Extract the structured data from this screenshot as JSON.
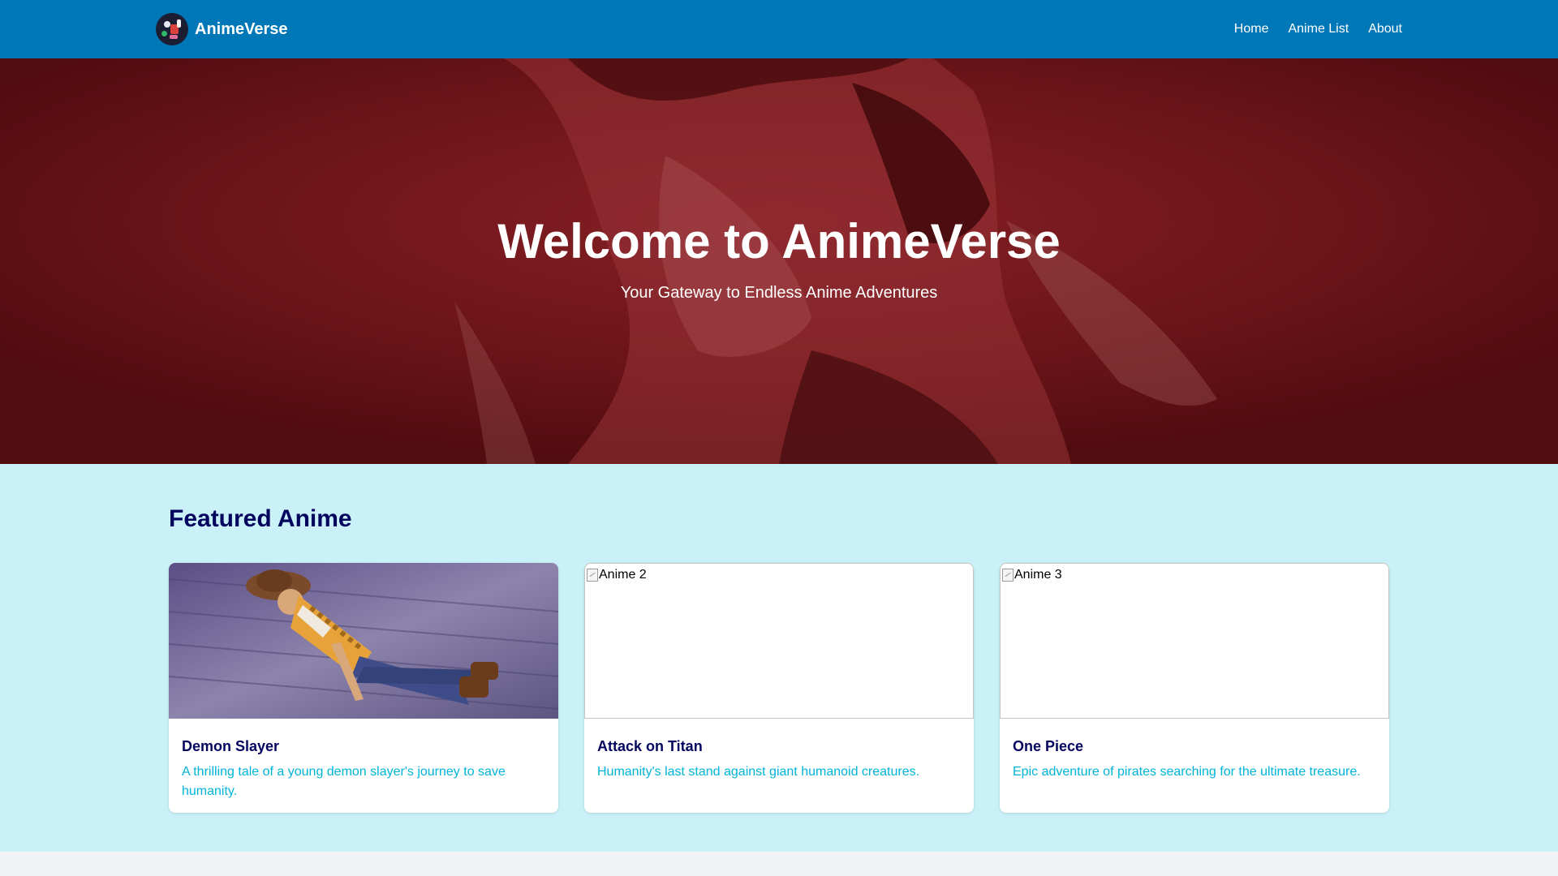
{
  "brand": {
    "name": "AnimeVerse",
    "logo_icon": "anime-characters-logo"
  },
  "nav": {
    "links": [
      {
        "label": "Home"
      },
      {
        "label": "Anime List"
      },
      {
        "label": "About"
      }
    ]
  },
  "hero": {
    "title": "Welcome to AnimeVerse",
    "subtitle": "Your Gateway to Endless Anime Adventures",
    "background_color": "#5c1618"
  },
  "featured": {
    "title": "Featured Anime",
    "cards": [
      {
        "title": "Demon Slayer",
        "description": "A thrilling tale of a young demon slayer's journey to save humanity.",
        "image_alt": "Anime 1",
        "image_loaded": true
      },
      {
        "title": "Attack on Titan",
        "description": "Humanity's last stand against giant humanoid creatures.",
        "image_alt": "Anime 2",
        "image_loaded": false
      },
      {
        "title": "One Piece",
        "description": "Epic adventure of pirates searching for the ultimate treasure.",
        "image_alt": "Anime 3",
        "image_loaded": false
      }
    ]
  },
  "colors": {
    "navbar": "#0077b6",
    "section_bg": "#caf0f8",
    "heading": "#03045e",
    "accent_text": "#00b4d8"
  }
}
